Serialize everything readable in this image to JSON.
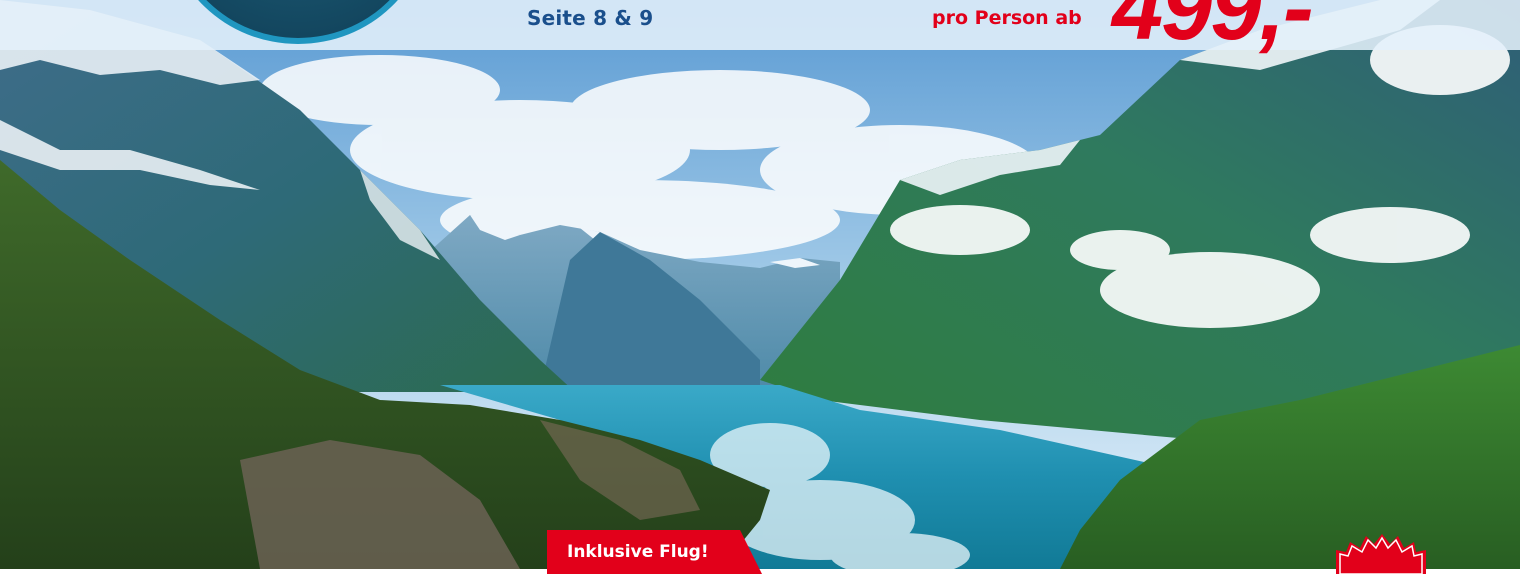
{
  "header": {
    "page_reference": "Seite 8 & 9",
    "price_label": "pro Person ab",
    "price_value": "499,-"
  },
  "promo_tag": {
    "label": "Inklusive Flug!"
  },
  "colors": {
    "accent_red": "#e2001a",
    "brand_blue": "#1a4f8c",
    "water_teal": "#1f96c0"
  },
  "image": {
    "subject": "fjord-landscape"
  }
}
